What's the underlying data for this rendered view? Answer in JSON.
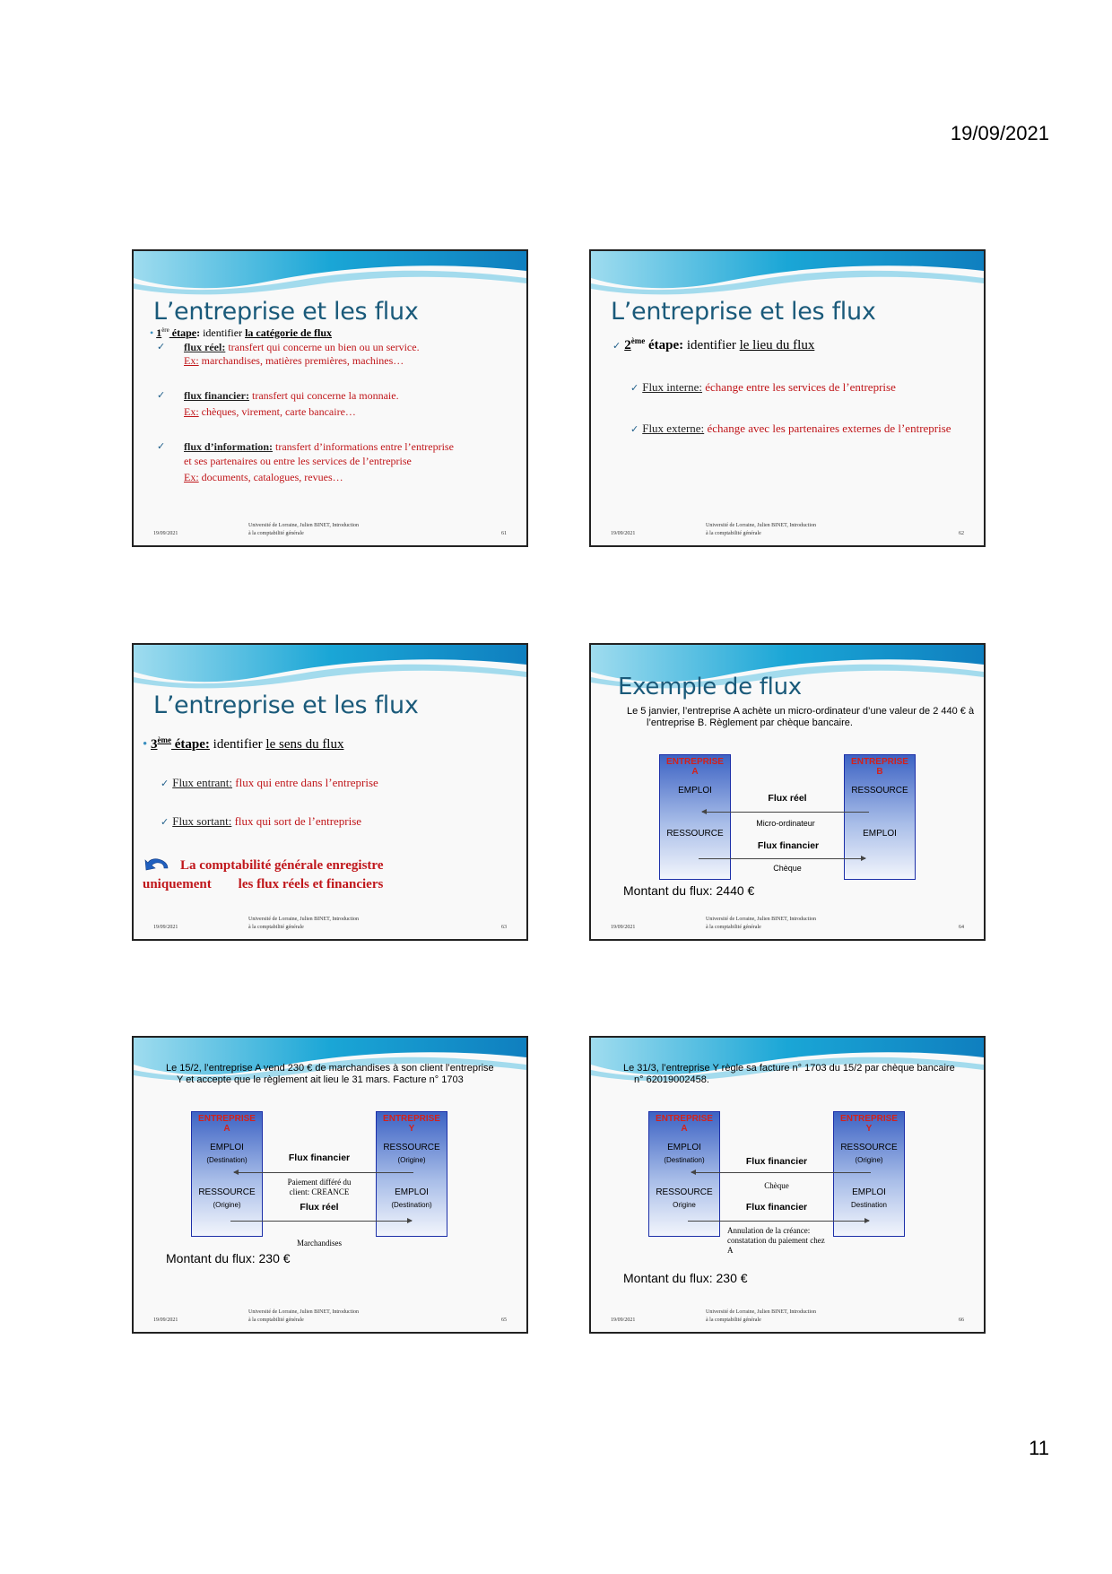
{
  "page": {
    "date": "19/09/2021",
    "number": "11"
  },
  "footer": {
    "date": "19/09/2021",
    "source_line1": "Université de Lorraine, Julien BINET, Introduction",
    "source_line2": "à la comptabilité générale"
  },
  "slide61": {
    "title": "L’entreprise et les flux",
    "step_num": "1",
    "step_sup": "ère",
    "step_word": " étape",
    "step_text": " identifier ",
    "step_focus": "la catégorie de flux",
    "items": [
      {
        "term": "flux réel:",
        "def": " transfert qui concerne un bien ou un service.",
        "ex_label": "Ex:",
        "ex": " marchandises, matières premières, machines…"
      },
      {
        "term": "flux financier:",
        "def": " transfert qui concerne la monnaie.",
        "ex_label": "Ex:",
        "ex": " chèques, virement, carte bancaire…"
      },
      {
        "term": "flux d’information:",
        "def": " transfert d’informations entre l’entreprise et ses partenaires ou entre les services de l’entreprise",
        "ex_label": "Ex:",
        "ex": " documents, catalogues, revues…"
      }
    ],
    "num": "61"
  },
  "slide62": {
    "title": "L’entreprise et les flux",
    "step_num": "2",
    "step_sup": "ème",
    "step_word": " étape:",
    "step_text": " identifier ",
    "step_focus": "le lieu du flux",
    "items": [
      {
        "term": "Flux interne:",
        "def": " échange entre les services de l’entreprise"
      },
      {
        "term": "Flux externe:",
        "def": " échange avec les partenaires externes de l’entreprise"
      }
    ],
    "num": "62"
  },
  "slide63": {
    "title": "L’entreprise et les flux",
    "step_num": "3",
    "step_sup": "ème",
    "step_word": " étape:",
    "step_text": " identifier ",
    "step_focus": "le sens du flux",
    "items": [
      {
        "term": "Flux entrant:",
        "def": " flux qui entre dans l’entreprise"
      },
      {
        "term": "Flux sortant:",
        "def": " flux qui sort de l’entreprise"
      }
    ],
    "conclusion_line1": "La comptabilité générale enregistre",
    "conclusion_line2": "uniquement        les flux réels et financiers",
    "num": "63"
  },
  "slide64": {
    "title": "Exemple de flux",
    "intro": "Le 5 janvier, l’entreprise A achète un micro-ordinateur d’une valeur de 2 440 € à l’entreprise B. Règlement par chèque bancaire.",
    "left": {
      "name1": "ENTREPRISE",
      "name2": "A",
      "top": "EMPLOI",
      "bottom": "RESSOURCE"
    },
    "right": {
      "name1": "ENTREPRISE",
      "name2": "B",
      "top": "RESSOURCE",
      "bottom": "EMPLOI"
    },
    "flow1": "Flux réel",
    "flow1_note": "Micro-ordinateur",
    "flow2": "Flux financier",
    "flow2_note": "Chèque",
    "montant": "Montant du flux: 2440 €",
    "num": "64"
  },
  "slide65": {
    "intro": "Le 15/2, l’entreprise A vend 230 € de marchandises à son client l’entreprise Y et accepte que le règlement ait lieu le 31 mars. Facture n° 1703",
    "left": {
      "name1": "ENTREPRISE",
      "name2": "A",
      "top": "EMPLOI",
      "top_sub": "(Destination)",
      "bottom": "RESSOURCE",
      "bottom_sub": "(Origine)"
    },
    "right": {
      "name1": "ENTREPRISE",
      "name2": "Y",
      "top": "RESSOURCE",
      "top_sub": "(Origine)",
      "bottom": "EMPLOI",
      "bottom_sub": "(Destination)"
    },
    "flow1": "Flux financier",
    "flow1_note": "Paiement différé du client: CREANCE",
    "flow2": "Flux réel",
    "flow2_note": "Marchandises",
    "montant": "Montant du flux: 230 €",
    "num": "65"
  },
  "slide66": {
    "intro": "Le 31/3, l’entreprise Y règle sa facture n° 1703 du 15/2 par chèque bancaire n° 62019002458.",
    "left": {
      "name1": "ENTREPRISE",
      "name2": "A",
      "top": "EMPLOI",
      "top_sub": "(Destination)",
      "bottom": "RESSOURCE",
      "bottom_sub": "Origine"
    },
    "right": {
      "name1": "ENTREPRISE",
      "name2": "Y",
      "top": "RESSOURCE",
      "top_sub": "(Origine)",
      "bottom": "EMPLOI",
      "bottom_sub": "Destination"
    },
    "flow1": "Flux financier",
    "flow1_note": "Chèque",
    "flow2": "Flux financier",
    "flow2_note": "Annulation de la créance: constatation du paiement chez A",
    "montant": "Montant du flux: 230 €",
    "num": "66"
  }
}
